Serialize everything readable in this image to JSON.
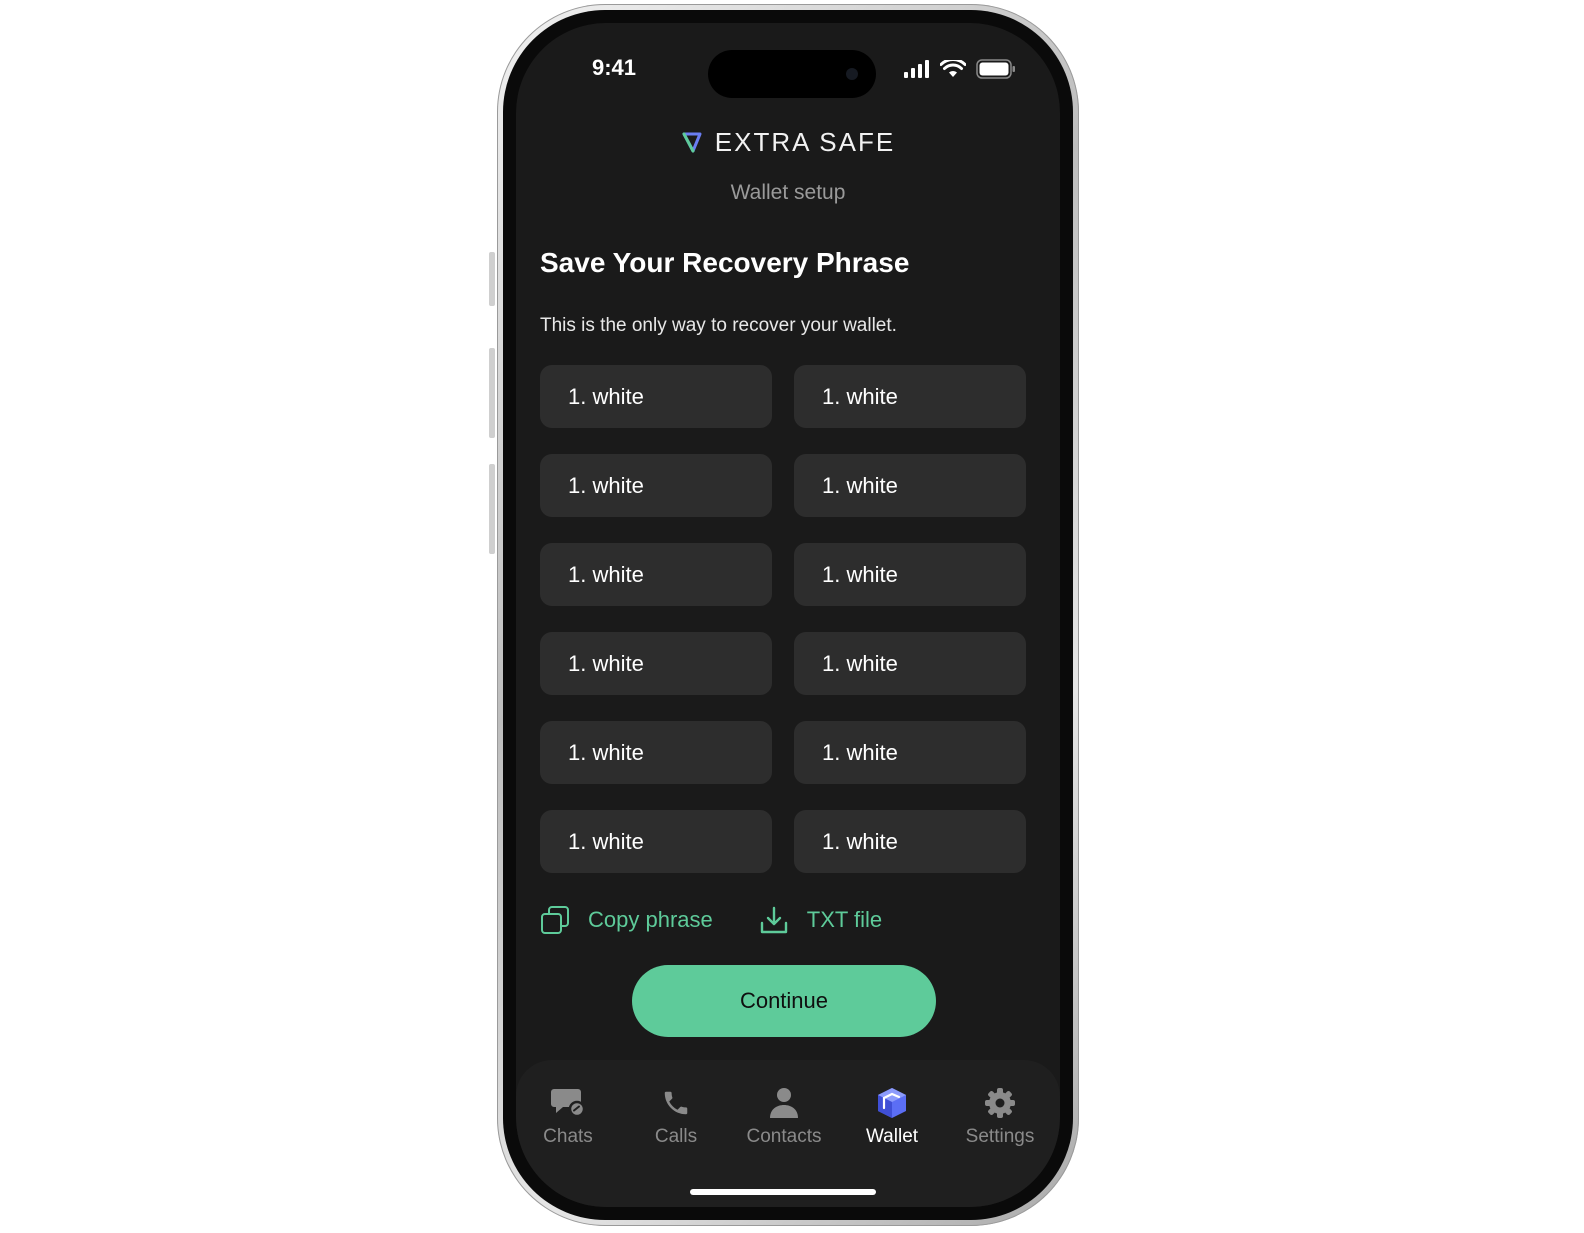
{
  "status_bar": {
    "time": "9:41"
  },
  "header": {
    "brand": "EXTRA SAFE",
    "subtitle": "Wallet setup"
  },
  "main": {
    "title": "Save Your Recovery Phrase",
    "description": "This is the only way to recover your wallet.",
    "words": [
      "1. white",
      "1. white",
      "1. white",
      "1. white",
      "1. white",
      "1. white",
      "1. white",
      "1. white",
      "1. white",
      "1. white",
      "1. white",
      "1. white"
    ],
    "copy_label": "Copy phrase",
    "txt_label": "TXT file",
    "continue_label": "Continue"
  },
  "tabbar": {
    "items": [
      {
        "label": "Chats",
        "icon": "chat-icon"
      },
      {
        "label": "Calls",
        "icon": "phone-icon"
      },
      {
        "label": "Contacts",
        "icon": "person-icon"
      },
      {
        "label": "Wallet",
        "icon": "wallet-cube-icon"
      },
      {
        "label": "Settings",
        "icon": "gear-icon"
      }
    ],
    "active": "Wallet"
  },
  "colors": {
    "accent": "#5ecb9a",
    "background": "#1a1a1a",
    "tile": "#2d2d2d",
    "wallet_icon": "#5b6ef5"
  }
}
